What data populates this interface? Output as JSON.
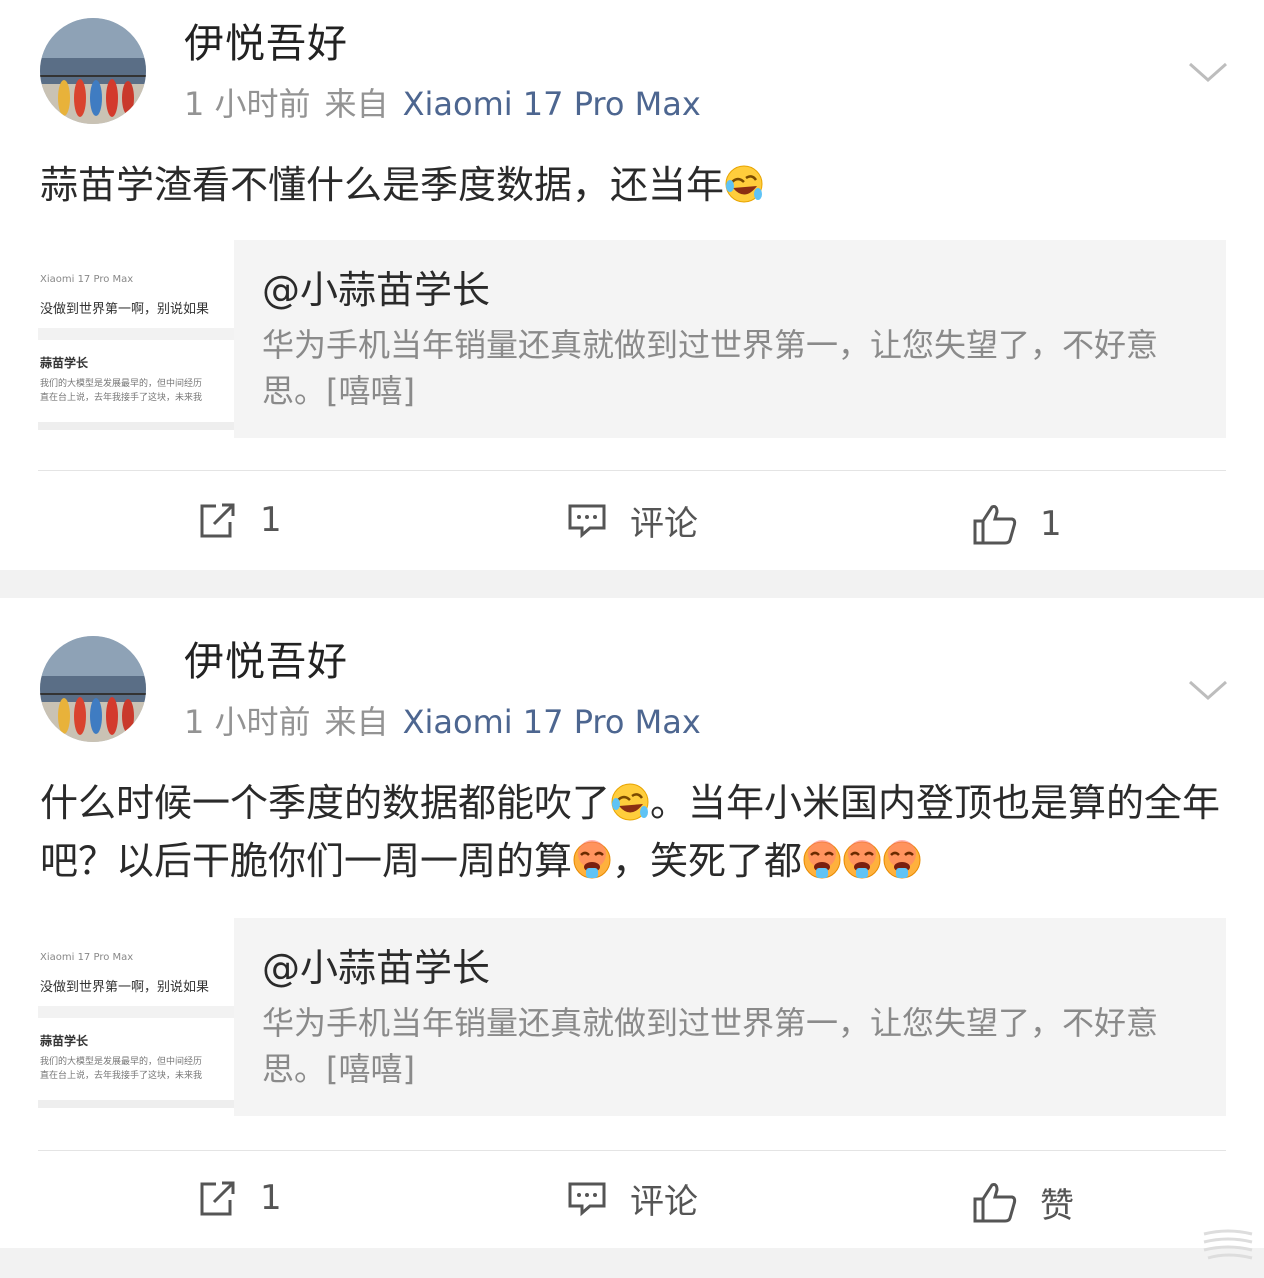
{
  "colors": {
    "background": "#f2f2f2",
    "card": "#ffffff",
    "source_link": "#4d6690",
    "meta_text": "#939393",
    "quote_bg": "#f4f4f4"
  },
  "posts": [
    {
      "username": "伊悦吾好",
      "time": "1 小时前",
      "from_label": "来自",
      "source": "Xiaomi 17 Pro Max",
      "content_parts": [
        "蒜苗学渣看不懂什么是季度数据，还当年"
      ],
      "emojis": [
        "laugh-cry-emoji"
      ],
      "quote": {
        "thumb_device": "Xiaomi 17 Pro Max",
        "thumb_line1": "没做到世界第一啊，别说如果",
        "thumb_name": "蒜苗学长",
        "thumb_line2": "我们的大模型是发展最早的，但中间经历",
        "thumb_line3": "直在台上说，去年我接手了这块，未来我",
        "title": "@小蒜苗学长",
        "text": "华为手机当年销量还真就做到过世界第一，让您失望了，不好意思。[嘻嘻]"
      },
      "actions": {
        "repost_icon": "share-icon",
        "repost_count": "1",
        "comment_icon": "comment-icon",
        "comment_label": "评论",
        "like_icon": "thumbs-up-icon",
        "like_label": "1"
      }
    },
    {
      "username": "伊悦吾好",
      "time": "1 小时前",
      "from_label": "来自",
      "source": "Xiaomi 17 Pro Max",
      "content_parts": [
        "什么时候一个季度的数据都能吹了",
        "。当年小米国内登顶也是算的全年吧？以后干脆你们一周一周的算",
        "，笑死了都"
      ],
      "emojis": [
        "laugh-cry-emoji",
        "hot-face-emoji",
        "hot-face-emoji"
      ],
      "quote": {
        "thumb_device": "Xiaomi 17 Pro Max",
        "thumb_line1": "没做到世界第一啊，别说如果",
        "thumb_name": "蒜苗学长",
        "thumb_line2": "我们的大模型是发展最早的，但中间经历",
        "thumb_line3": "直在台上说，去年我接手了这块，未来我",
        "title": "@小蒜苗学长",
        "text": "华为手机当年销量还真就做到过世界第一，让您失望了，不好意思。[嘻嘻]"
      },
      "actions": {
        "repost_icon": "share-icon",
        "repost_count": "1",
        "comment_icon": "comment-icon",
        "comment_label": "评论",
        "like_icon": "thumbs-up-icon",
        "like_label": "赞"
      }
    }
  ]
}
